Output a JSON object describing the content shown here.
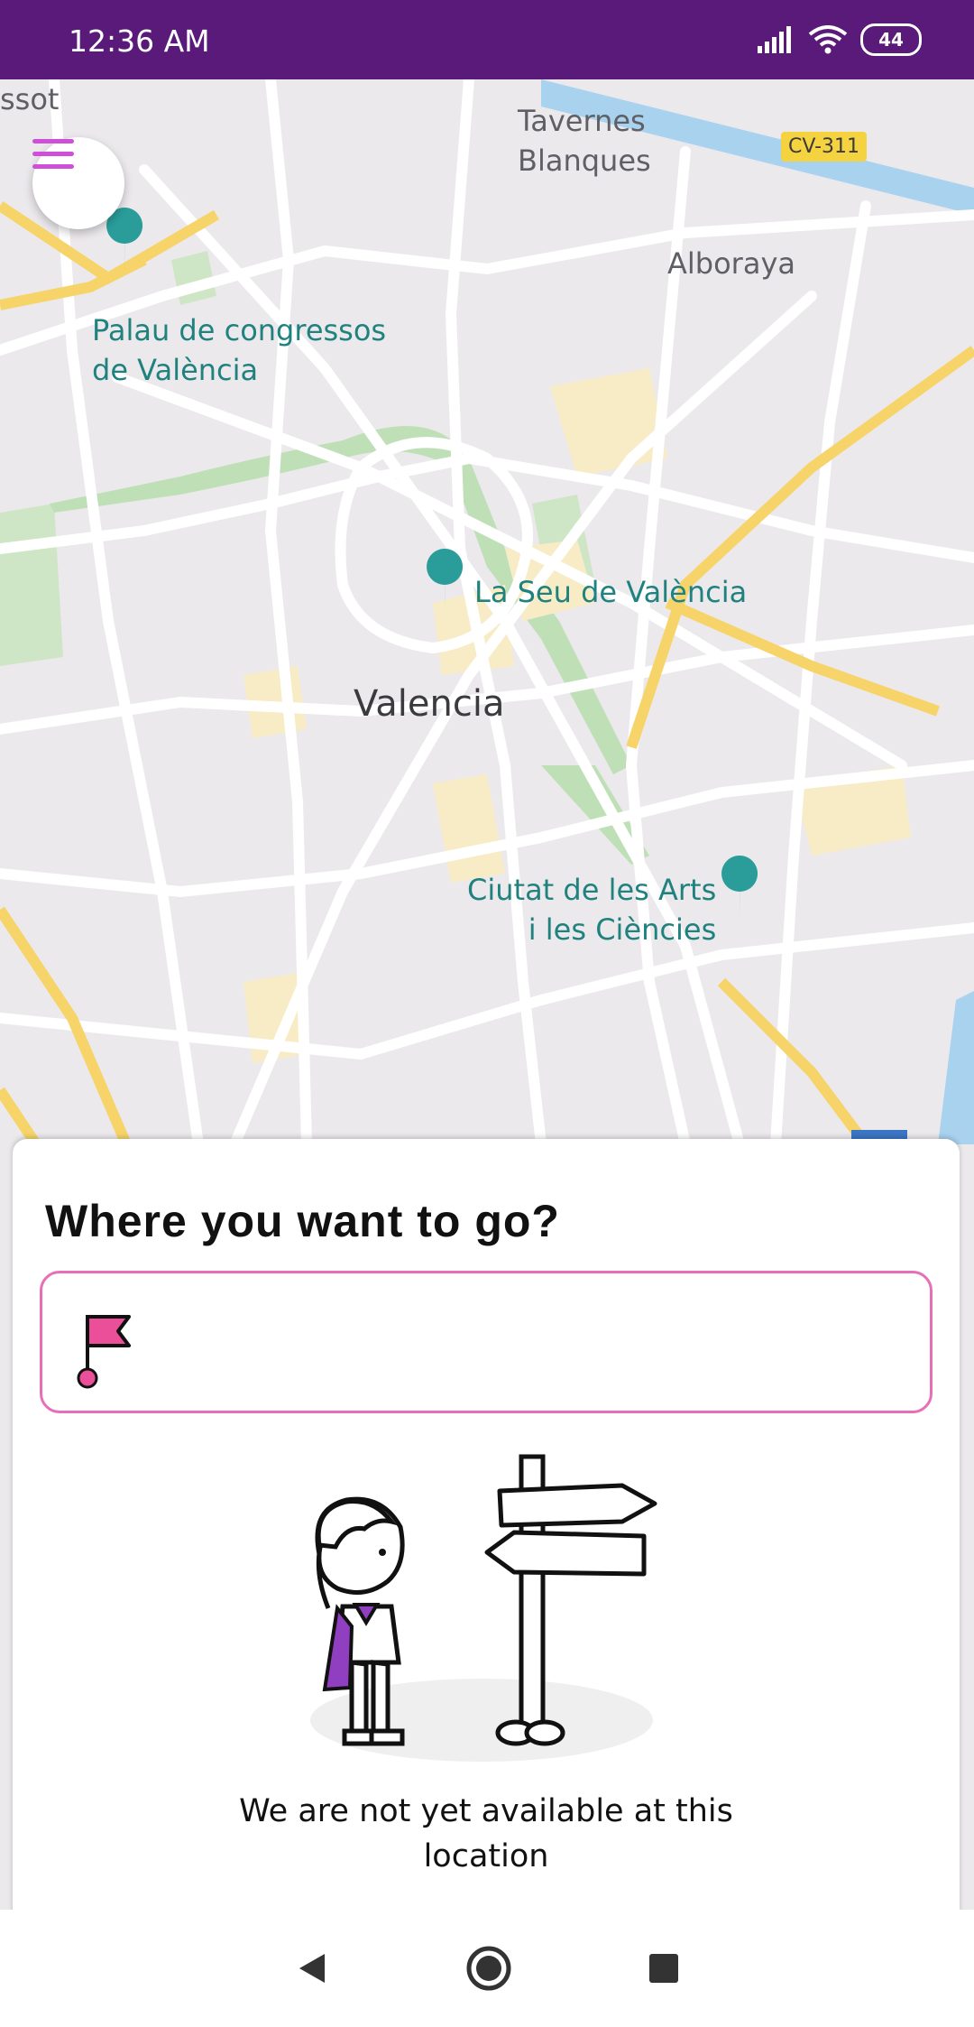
{
  "status_bar": {
    "time": "12:36 AM",
    "battery": "44"
  },
  "map": {
    "labels": {
      "ssot": "ssot",
      "tavernes": "Tavernes\nBlanques",
      "alboraya": "Alboraya",
      "palau": "Palau de congressos\nde València",
      "seu": "La Seu de València",
      "city": "Valencia",
      "ciutat": "Ciutat de les Arts\ni les Ciències"
    },
    "road_shield": "CV-311",
    "colors": {
      "land": "#ece9ed",
      "road": "#ffffff",
      "highway": "#f6d46a",
      "park": "#b8dfb0",
      "water": "#a9d2ef",
      "poi": "#2a9d9a"
    }
  },
  "sheet": {
    "title": "Where you want to go?",
    "destination": {
      "value": "",
      "placeholder": ""
    },
    "message": "We are not yet available at this location"
  }
}
